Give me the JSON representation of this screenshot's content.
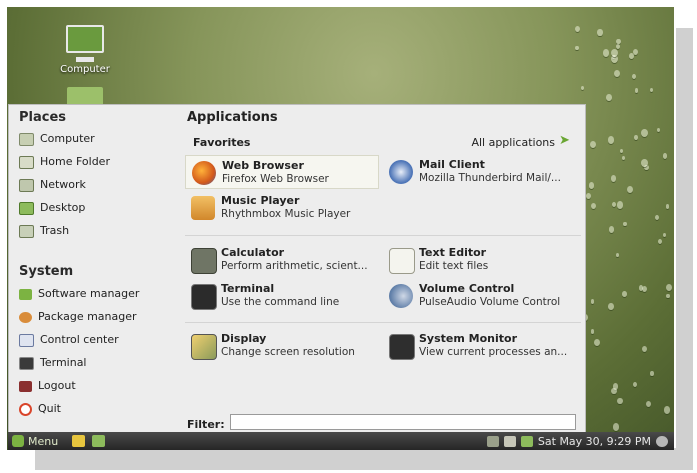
{
  "desktop": {
    "icons": [
      {
        "label": "Computer",
        "icon": "computer-icon"
      },
      {
        "label": "",
        "icon": "folder-icon"
      }
    ]
  },
  "menu": {
    "places_title": "Places",
    "places": [
      {
        "label": "Computer",
        "icon": "computer-icon"
      },
      {
        "label": "Home Folder",
        "icon": "home-folder-icon"
      },
      {
        "label": "Network",
        "icon": "network-icon"
      },
      {
        "label": "Desktop",
        "icon": "desktop-icon"
      },
      {
        "label": "Trash",
        "icon": "trash-icon"
      }
    ],
    "system_title": "System",
    "system": [
      {
        "label": "Software manager",
        "icon": "software-manager-icon"
      },
      {
        "label": "Package manager",
        "icon": "package-manager-icon"
      },
      {
        "label": "Control center",
        "icon": "control-center-icon"
      },
      {
        "label": "Terminal",
        "icon": "terminal-icon"
      },
      {
        "label": "Logout",
        "icon": "logout-icon"
      },
      {
        "label": "Quit",
        "icon": "quit-icon"
      }
    ],
    "applications_title": "Applications",
    "favorites_title": "Favorites",
    "all_applications": "All applications",
    "apps": [
      {
        "name": "Web Browser",
        "desc": "Firefox Web Browser",
        "icon": "firefox-icon",
        "selected": true
      },
      {
        "name": "Mail Client",
        "desc": "Mozilla Thunderbird Mail/...",
        "icon": "thunderbird-icon"
      },
      {
        "name": "Music Player",
        "desc": "Rhythmbox Music Player",
        "icon": "rhythmbox-icon"
      },
      {
        "name": "Calculator",
        "desc": "Perform arithmetic, scient...",
        "icon": "calculator-icon"
      },
      {
        "name": "Text Editor",
        "desc": "Edit text files",
        "icon": "text-editor-icon"
      },
      {
        "name": "Terminal",
        "desc": "Use the command line",
        "icon": "terminal-icon"
      },
      {
        "name": "Volume Control",
        "desc": "PulseAudio Volume Control",
        "icon": "volume-control-icon"
      },
      {
        "name": "Display",
        "desc": "Change screen resolution",
        "icon": "display-icon"
      },
      {
        "name": "System Monitor",
        "desc": "View current processes an...",
        "icon": "system-monitor-icon"
      }
    ],
    "filter_label": "Filter:",
    "filter_value": ""
  },
  "panel": {
    "menu_label": "Menu",
    "clock": "Sat May 30,  9:29 PM"
  },
  "colors": {
    "menu_bg": "#ededed",
    "panel_bg": "#2e2e2e",
    "mint_accent": "#7cb342"
  }
}
